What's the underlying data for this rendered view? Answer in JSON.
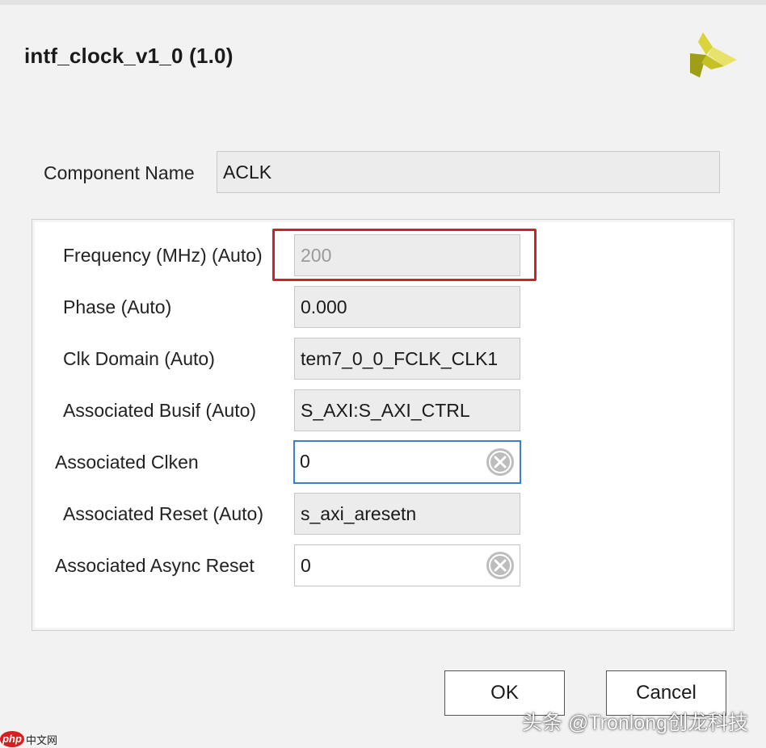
{
  "dialog": {
    "title": "intf_clock_v1_0 (1.0)"
  },
  "component": {
    "label": "Component Name",
    "value": "ACLK"
  },
  "params": [
    {
      "label": "Frequency (MHz) (Auto)",
      "value": "200",
      "disabled": true
    },
    {
      "label": "Phase (Auto)",
      "value": "0.000"
    },
    {
      "label": "Clk Domain (Auto)",
      "value": "tem7_0_0_FCLK_CLK1"
    },
    {
      "label": "Associated Busif (Auto)",
      "value": "S_AXI:S_AXI_CTRL"
    },
    {
      "label": "Associated Clken",
      "value": "0",
      "editable": true,
      "focused": true
    },
    {
      "label": "Associated Reset (Auto)",
      "value": "s_axi_aresetn"
    },
    {
      "label": "Associated Async Reset",
      "value": "0",
      "editable": true
    }
  ],
  "buttons": {
    "ok": "OK",
    "cancel": "Cancel"
  },
  "icons": {
    "logo": "xilinx-logo-icon",
    "clear": "clear-circle-x-icon"
  },
  "colors": {
    "highlight": "#d21f2a",
    "focus": "#3d7fcf",
    "logo_yellow": "#c8c21e",
    "logo_green": "#a3a418"
  },
  "watermark": {
    "text": "头条 @Tronlong创龙科技",
    "badge_php": "php",
    "badge_cn": "中文网"
  }
}
